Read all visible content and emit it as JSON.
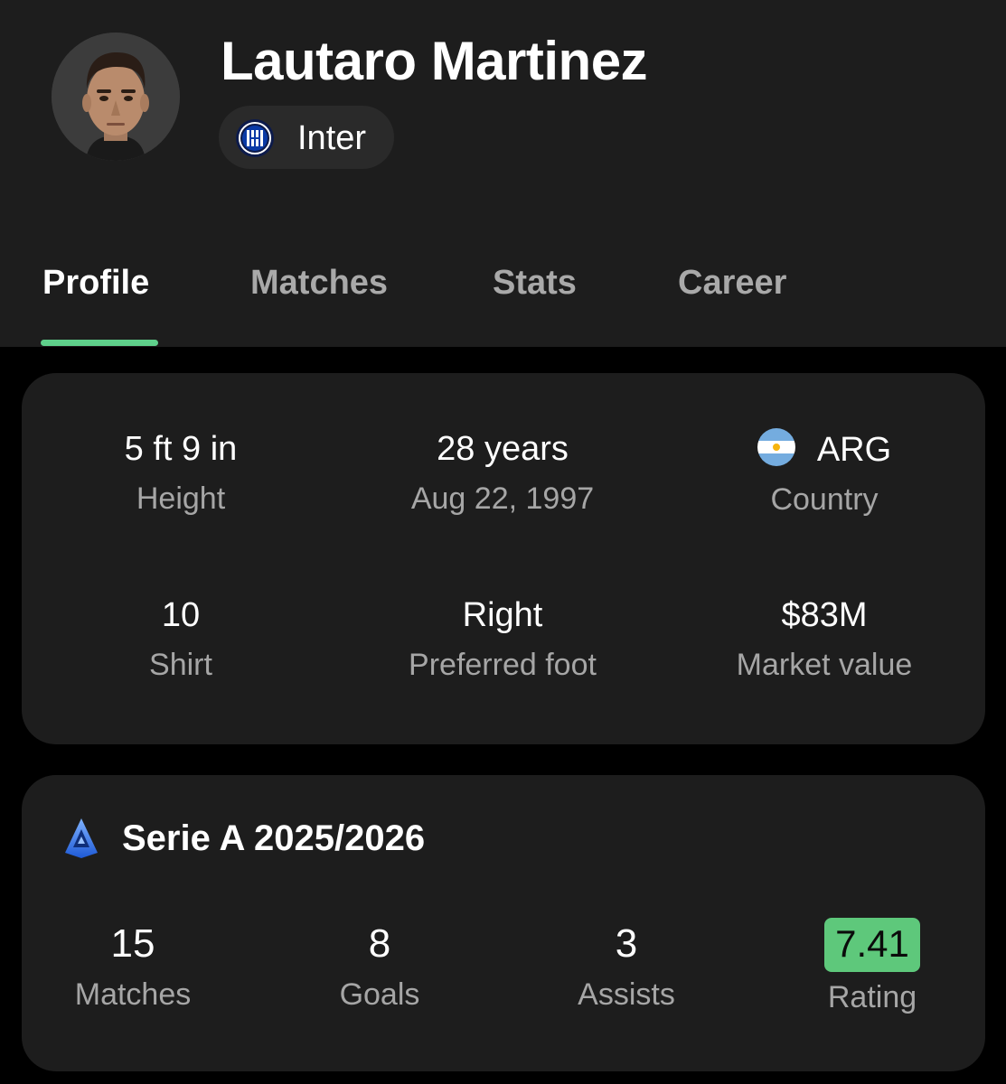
{
  "player": {
    "name": "Lautaro Martinez",
    "team": "Inter"
  },
  "tabs": [
    {
      "label": "Profile",
      "active": true
    },
    {
      "label": "Matches",
      "active": false
    },
    {
      "label": "Stats",
      "active": false
    },
    {
      "label": "Career",
      "active": false
    }
  ],
  "profile": {
    "height": {
      "value": "5 ft 9 in",
      "label": "Height"
    },
    "age": {
      "value": "28 years",
      "label": "Aug 22, 1997"
    },
    "country": {
      "value": "ARG",
      "label": "Country",
      "flag_icon": "argentina-flag-icon"
    },
    "shirt": {
      "value": "10",
      "label": "Shirt"
    },
    "foot": {
      "value": "Right",
      "label": "Preferred foot"
    },
    "market_value": {
      "value": "$83M",
      "label": "Market value"
    }
  },
  "season": {
    "title": "Serie A 2025/2026",
    "league_icon": "serie-a-logo-icon",
    "stats": [
      {
        "value": "15",
        "label": "Matches"
      },
      {
        "value": "8",
        "label": "Goals"
      },
      {
        "value": "3",
        "label": "Assists"
      },
      {
        "value": "7.41",
        "label": "Rating"
      }
    ]
  },
  "colors": {
    "accent": "#5fd08b",
    "rating_badge": "#5ec87b",
    "card_bg": "#1d1d1d",
    "page_bg": "#000000"
  }
}
